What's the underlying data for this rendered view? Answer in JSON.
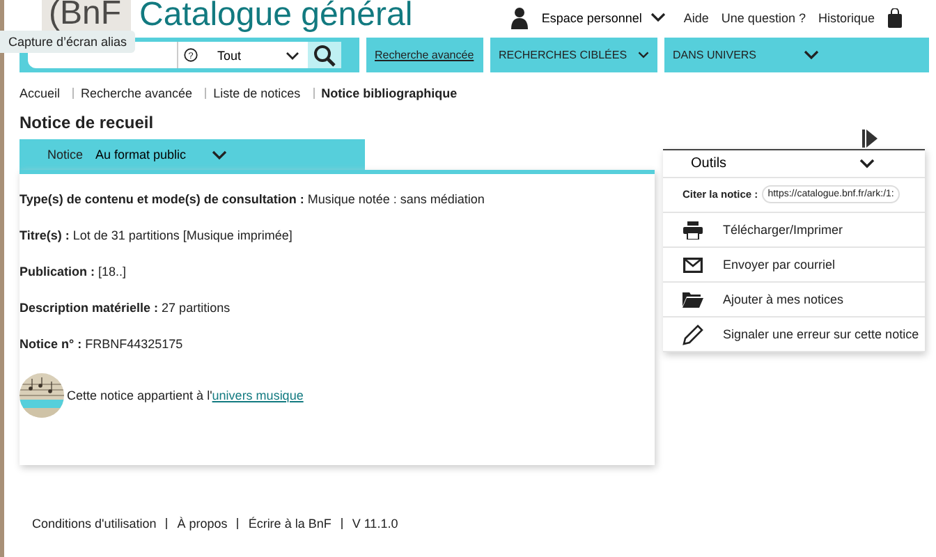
{
  "header": {
    "logo": "(BnF",
    "title": "Catalogue général",
    "account": "Espace personnel",
    "links": [
      "Aide",
      "Une question ?",
      "Historique"
    ]
  },
  "tooltip": "Capture d’écran alias",
  "search": {
    "help": "?",
    "scope": "Tout",
    "nav": [
      {
        "label": "Recherche avancée",
        "kind": "link"
      },
      {
        "label": "RECHERCHES CIBLÉES",
        "kind": "menu"
      },
      {
        "label": "DANS UNIVERS",
        "kind": "menu"
      }
    ]
  },
  "breadcrumb": [
    {
      "label": "Accueil",
      "current": false
    },
    {
      "label": "Recherche avancée",
      "current": false
    },
    {
      "label": "Liste de notices",
      "current": false
    },
    {
      "label": "Notice bibliographique",
      "current": true
    }
  ],
  "page_title": "Notice de recueil",
  "tab": {
    "label": "Notice",
    "format": "Au format public"
  },
  "fields": [
    {
      "label": "Type(s) de contenu et mode(s) de consultation :",
      "value": "Musique notée : sans médiation"
    },
    {
      "label": "Titre(s) :",
      "value": "Lot de 31 partitions [Musique imprimée]"
    },
    {
      "label": "Publication :",
      "value": "[18..]"
    },
    {
      "label": "Description matérielle :",
      "value": "27 partitions"
    },
    {
      "label": "Notice n° :",
      "value": "FRBNF44325175"
    }
  ],
  "universe": {
    "text": "Cette notice appartient à l'",
    "link": "univers musique"
  },
  "tools": {
    "title": "Outils",
    "cite_label": "Citer la notice :",
    "cite_value": "https://catalogue.bnf.fr/ark:/1:",
    "items": [
      {
        "label": "Télécharger/Imprimer",
        "kind": "print"
      },
      {
        "label": "Envoyer par courriel",
        "kind": "mail"
      },
      {
        "label": "Ajouter à mes notices",
        "kind": "folder"
      },
      {
        "label": "Signaler une erreur sur cette notice",
        "kind": "pencil"
      }
    ]
  },
  "footer": [
    "Conditions d'utilisation",
    "À propos",
    "Écrire à la BnF",
    "V 11.1.0"
  ]
}
